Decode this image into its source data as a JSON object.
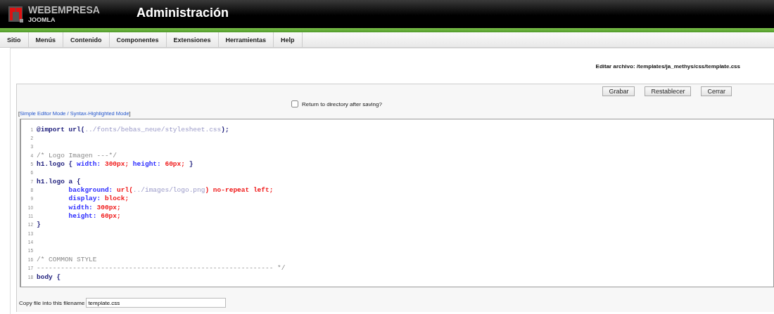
{
  "header": {
    "brand": "WEBEMPRESA",
    "brand_sub": "JOOMLA",
    "title": "Administración"
  },
  "menu": [
    {
      "label": "Sitio"
    },
    {
      "label": "Menús"
    },
    {
      "label": "Contenido"
    },
    {
      "label": "Componentes"
    },
    {
      "label": "Extensiones"
    },
    {
      "label": "Herramientas"
    },
    {
      "label": "Help"
    }
  ],
  "file_heading": "Editar archivo: /templates/ja_methys/css/template.css",
  "buttons": [
    "Grabar",
    "Restablecer",
    "Cerrar"
  ],
  "return_option": {
    "label": "Return to directory after saving?",
    "checked": false
  },
  "mode_link": {
    "before": "[",
    "label": "Simple Editor Mode / Syntax-Highlighted Mode",
    "after": "]"
  },
  "code_lines": [
    {
      "number": "1",
      "tokens": [
        {
          "kind": "plain",
          "text": "@import url("
        },
        {
          "kind": "string",
          "text": "../fonts/bebas_neue/stylesheet.css"
        },
        {
          "kind": "plain",
          "text": ");"
        }
      ]
    },
    {
      "number": "2"
    },
    {
      "number": "3"
    },
    {
      "number": "4",
      "tokens": [
        {
          "kind": "comment",
          "text": "/* Logo Imagen ---*/"
        }
      ]
    },
    {
      "number": "5",
      "tokens": [
        {
          "kind": "plain",
          "text": "h1.logo { "
        },
        {
          "kind": "property",
          "text": "width:"
        },
        {
          "kind": "value",
          "text": " 300px;"
        },
        {
          "kind": "property",
          "text": " height:"
        },
        {
          "kind": "value",
          "text": " 60px;"
        },
        {
          "kind": "plain",
          "text": " }"
        }
      ]
    },
    {
      "number": "6"
    },
    {
      "number": "7",
      "tokens": [
        {
          "kind": "plain",
          "text": "h1.logo a {"
        }
      ]
    },
    {
      "number": "8",
      "tokens": [
        {
          "kind": "property",
          "text": "        background:"
        },
        {
          "kind": "value",
          "text": " url("
        },
        {
          "kind": "string",
          "text": "../images/logo.png"
        },
        {
          "kind": "value",
          "text": ") no-repeat left;"
        }
      ]
    },
    {
      "number": "9",
      "tokens": [
        {
          "kind": "property",
          "text": "        display:"
        },
        {
          "kind": "value",
          "text": " block;"
        }
      ]
    },
    {
      "number": "10",
      "tokens": [
        {
          "kind": "property",
          "text": "        width:"
        },
        {
          "kind": "value",
          "text": " 300px;"
        }
      ]
    },
    {
      "number": "11",
      "tokens": [
        {
          "kind": "property",
          "text": "        height:"
        },
        {
          "kind": "value",
          "text": " 60px;"
        }
      ]
    },
    {
      "number": "12",
      "tokens": [
        {
          "kind": "plain",
          "text": "}"
        }
      ]
    },
    {
      "number": "13"
    },
    {
      "number": "14"
    },
    {
      "number": "15"
    },
    {
      "number": "16",
      "tokens": [
        {
          "kind": "comment",
          "text": "/* COMMON STYLE"
        }
      ]
    },
    {
      "number": "17",
      "tokens": [
        {
          "kind": "comment",
          "text": "----------------------------------------------------------- */"
        }
      ]
    },
    {
      "number": "18",
      "tokens": [
        {
          "kind": "plain",
          "text": "body {"
        }
      ]
    }
  ],
  "copy_file": {
    "label": "Copy file into this filename",
    "value": "template.css"
  }
}
